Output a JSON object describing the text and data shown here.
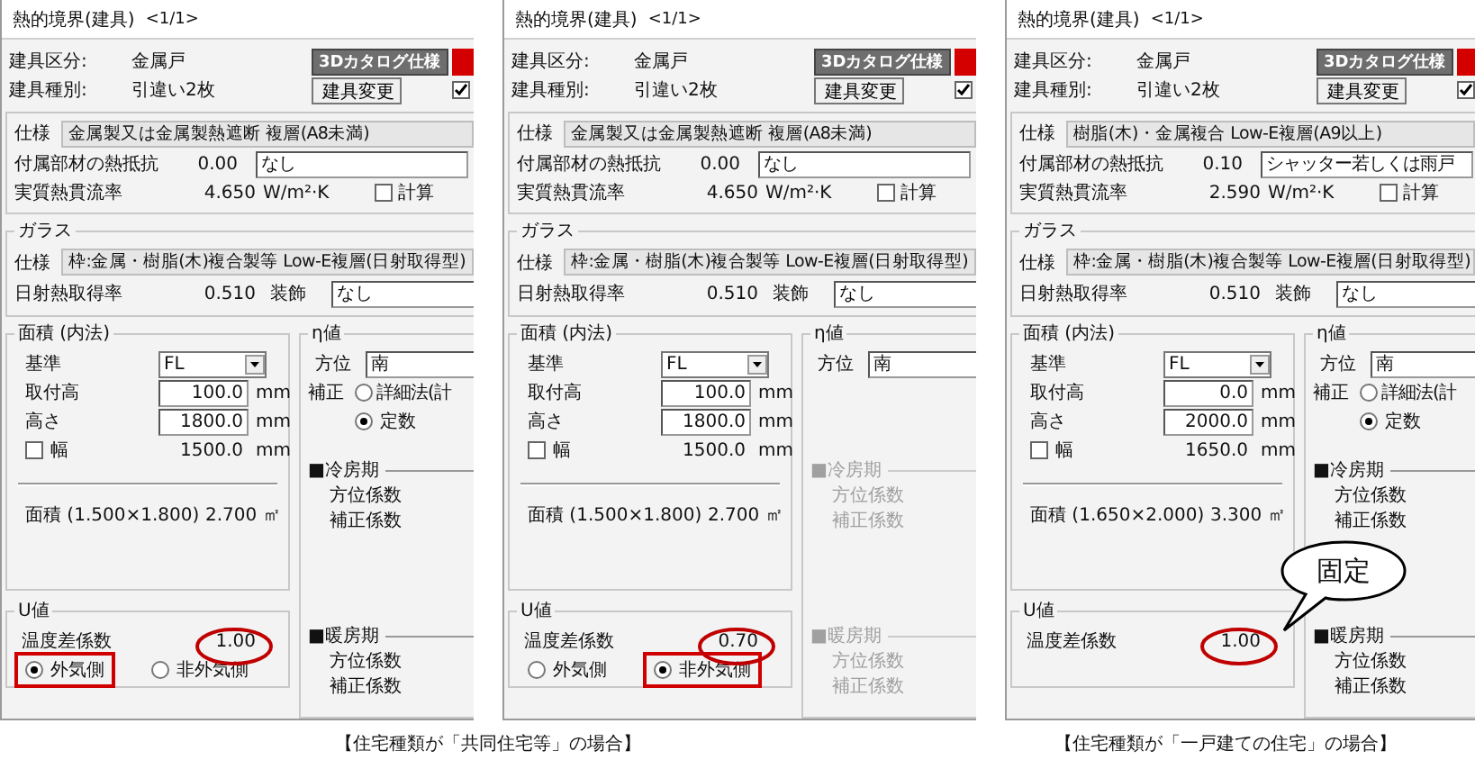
{
  "panels": [
    {
      "title": "熱的境界(建具)",
      "page": "<1/1>",
      "door_class": {
        "label": "建具区分:",
        "value": "金属戸"
      },
      "door_kind": {
        "label": "建具種別:",
        "value": "引違い2枚"
      },
      "catalog_button": "3Dカタログ仕様",
      "change_button": "建具変更",
      "option_checkbox": {
        "checked": true
      },
      "frame": {
        "spec_label": "仕様",
        "spec": "金属製又は金属製熱遮断 複層(A8未満)",
        "resistance_label": "付属部材の熱抵抗",
        "resistance": "0.00",
        "accessory": "なし",
        "u_label": "実質熱貫流率",
        "u": "4.650",
        "u_unit": "W/m²·K",
        "calc": {
          "label": "計算",
          "checked": false
        }
      },
      "glass": {
        "legend": "ガラス",
        "spec_label": "仕様",
        "spec": "枠:金属・樹脂(木)複合製等 Low-E複層(日射取得型)",
        "solar_label": "日射熱取得率",
        "solar": "0.510",
        "decor_label": "装飾",
        "decor": "なし"
      },
      "area": {
        "legend": "面積 (内法)",
        "base_label": "基準",
        "base": "FL",
        "mount": {
          "label": "取付高",
          "value": "100.0",
          "unit": "mm"
        },
        "height": {
          "label": "高さ",
          "value": "1800.0",
          "unit": "mm"
        },
        "width": {
          "label": "幅",
          "checked": false,
          "value": "1500.0",
          "unit": "mm"
        },
        "area_label": "面積 (1.500×1.800)",
        "area_value": "2.700",
        "area_unit": "㎡"
      },
      "eta": {
        "legend": "η値",
        "enabled": true,
        "direction_label": "方位",
        "direction": "南",
        "correction": {
          "label": "補正",
          "options": [
            {
              "label": "詳細法(計",
              "selected": false
            },
            {
              "label": "定数",
              "selected": true
            }
          ]
        },
        "cooling": {
          "heading": "■冷房期",
          "rows": [
            "方位係数",
            "補正係数"
          ]
        },
        "heating": {
          "heading": "■暖房期",
          "rows": [
            "方位係数",
            "補正係数"
          ]
        }
      },
      "u_value": {
        "legend": "U値",
        "coef_label": "温度差係数",
        "coef": "1.00",
        "circled": true,
        "sides": [
          {
            "label": "外気側",
            "selected": true,
            "boxed": true
          },
          {
            "label": "非外気側",
            "selected": false,
            "boxed": false
          }
        ]
      }
    },
    {
      "title": "熱的境界(建具)",
      "page": "<1/1>",
      "door_class": {
        "label": "建具区分:",
        "value": "金属戸"
      },
      "door_kind": {
        "label": "建具種別:",
        "value": "引違い2枚"
      },
      "catalog_button": "3Dカタログ仕様",
      "change_button": "建具変更",
      "option_checkbox": {
        "checked": true
      },
      "frame": {
        "spec_label": "仕様",
        "spec": "金属製又は金属製熱遮断 複層(A8未満)",
        "resistance_label": "付属部材の熱抵抗",
        "resistance": "0.00",
        "accessory": "なし",
        "u_label": "実質熱貫流率",
        "u": "4.650",
        "u_unit": "W/m²·K",
        "calc": {
          "label": "計算",
          "checked": false
        }
      },
      "glass": {
        "legend": "ガラス",
        "spec_label": "仕様",
        "spec": "枠:金属・樹脂(木)複合製等 Low-E複層(日射取得型)",
        "solar_label": "日射熱取得率",
        "solar": "0.510",
        "decor_label": "装飾",
        "decor": "なし"
      },
      "area": {
        "legend": "面積 (内法)",
        "base_label": "基準",
        "base": "FL",
        "mount": {
          "label": "取付高",
          "value": "100.0",
          "unit": "mm"
        },
        "height": {
          "label": "高さ",
          "value": "1800.0",
          "unit": "mm"
        },
        "width": {
          "label": "幅",
          "checked": false,
          "value": "1500.0",
          "unit": "mm"
        },
        "area_label": "面積 (1.500×1.800)",
        "area_value": "2.700",
        "area_unit": "㎡"
      },
      "eta": {
        "legend": "η値",
        "enabled": false,
        "direction_label": "方位",
        "direction": "南",
        "cooling": {
          "heading": "■冷房期",
          "rows": [
            "方位係数",
            "補正係数"
          ]
        },
        "heating": {
          "heading": "■暖房期",
          "rows": [
            "方位係数",
            "補正係数"
          ]
        }
      },
      "u_value": {
        "legend": "U値",
        "coef_label": "温度差係数",
        "coef": "0.70",
        "circled": true,
        "sides": [
          {
            "label": "外気側",
            "selected": false,
            "boxed": false
          },
          {
            "label": "非外気側",
            "selected": true,
            "boxed": true
          }
        ]
      }
    },
    {
      "title": "熱的境界(建具)",
      "page": "<1/1>",
      "door_class": {
        "label": "建具区分:",
        "value": "金属戸"
      },
      "door_kind": {
        "label": "建具種別:",
        "value": "引違い2枚"
      },
      "catalog_button": "3Dカタログ仕様",
      "change_button": "建具変更",
      "option_checkbox": {
        "checked": true
      },
      "frame": {
        "spec_label": "仕様",
        "spec": "樹脂(木)・金属複合 Low-E複層(A9以上)",
        "resistance_label": "付属部材の熱抵抗",
        "resistance": "0.10",
        "accessory": "シャッター若しくは雨戸",
        "u_label": "実質熱貫流率",
        "u": "2.590",
        "u_unit": "W/m²·K",
        "calc": {
          "label": "計算",
          "checked": false
        }
      },
      "glass": {
        "legend": "ガラス",
        "spec_label": "仕様",
        "spec": "枠:金属・樹脂(木)複合製等 Low-E複層(日射取得型)",
        "solar_label": "日射熱取得率",
        "solar": "0.510",
        "decor_label": "装飾",
        "decor": "なし"
      },
      "area": {
        "legend": "面積 (内法)",
        "base_label": "基準",
        "base": "FL",
        "mount": {
          "label": "取付高",
          "value": "0.0",
          "unit": "mm"
        },
        "height": {
          "label": "高さ",
          "value": "2000.0",
          "unit": "mm"
        },
        "width": {
          "label": "幅",
          "checked": false,
          "value": "1650.0",
          "unit": "mm"
        },
        "area_label": "面積 (1.650×2.000)",
        "area_value": "3.300",
        "area_unit": "㎡"
      },
      "eta": {
        "legend": "η値",
        "enabled": true,
        "direction_label": "方位",
        "direction": "南",
        "correction": {
          "label": "補正",
          "options": [
            {
              "label": "詳細法(計",
              "selected": false
            },
            {
              "label": "定数",
              "selected": true
            }
          ]
        },
        "cooling": {
          "heading": "■冷房期",
          "rows": [
            "方位係数",
            "補正係数"
          ]
        },
        "heating": {
          "heading": "■暖房期",
          "rows": [
            "方位係数",
            "補正係数"
          ]
        }
      },
      "u_value": {
        "legend": "U値",
        "coef_label": "温度差係数",
        "coef": "1.00",
        "circled": true,
        "callout": "固定"
      }
    }
  ],
  "captions": [
    "【住宅種類が「共同住宅等」の場合】",
    "【住宅種類が「一戸建ての住宅」の場合】"
  ]
}
